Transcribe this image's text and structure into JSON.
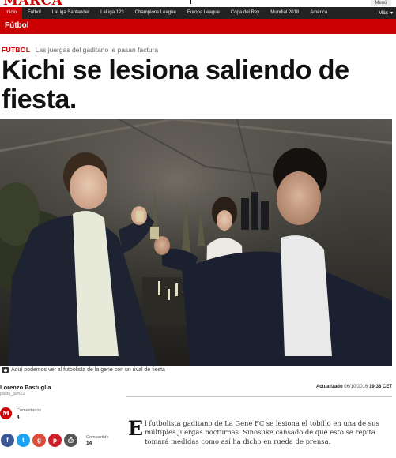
{
  "site": {
    "logo": "MARCA",
    "menu_label": "Menú"
  },
  "nav": {
    "items": [
      "Inicio",
      "Fútbol",
      "LaLiga Santander",
      "LaLiga 123",
      "Champions League",
      "Europa League",
      "Copa del Rey",
      "Mundial 2018",
      "América"
    ],
    "more": "Más"
  },
  "section": {
    "title": "Fútbol"
  },
  "article": {
    "category": "FÚTBOL",
    "subtitle": "Las juergas del gaditano le pasan factura",
    "headline": "Kichi se lesiona saliendo de fiesta.",
    "photo_caption": "Aquí podemos ver al futbolista de la gene con un rival de fiesta",
    "author": "Lorenzo Pastuglia",
    "author_handle": "pastu_jam22",
    "updated_label": "Actualizado",
    "updated_date": "06/10/2016",
    "updated_time": "19:38 CET",
    "comments_label": "Comentarios",
    "comments_count": "4",
    "share_label": "Compartido",
    "share_count": "14",
    "dropcap": "E",
    "body": "l futbolista gaditano de La Gene FC se lesiona el tobillo en una de sus múltiples juergas nocturnas. Sinosuke cansado de que esto se repita tomará medidas como así ha dicho en rueda de prensa."
  },
  "colors": {
    "brand": "#cc0000",
    "nav_bg": "#232323"
  },
  "icons": [
    "camera-icon",
    "facebook-icon",
    "twitter-icon",
    "google-plus-icon",
    "pinterest-icon",
    "print-icon",
    "chevron-down-icon"
  ]
}
